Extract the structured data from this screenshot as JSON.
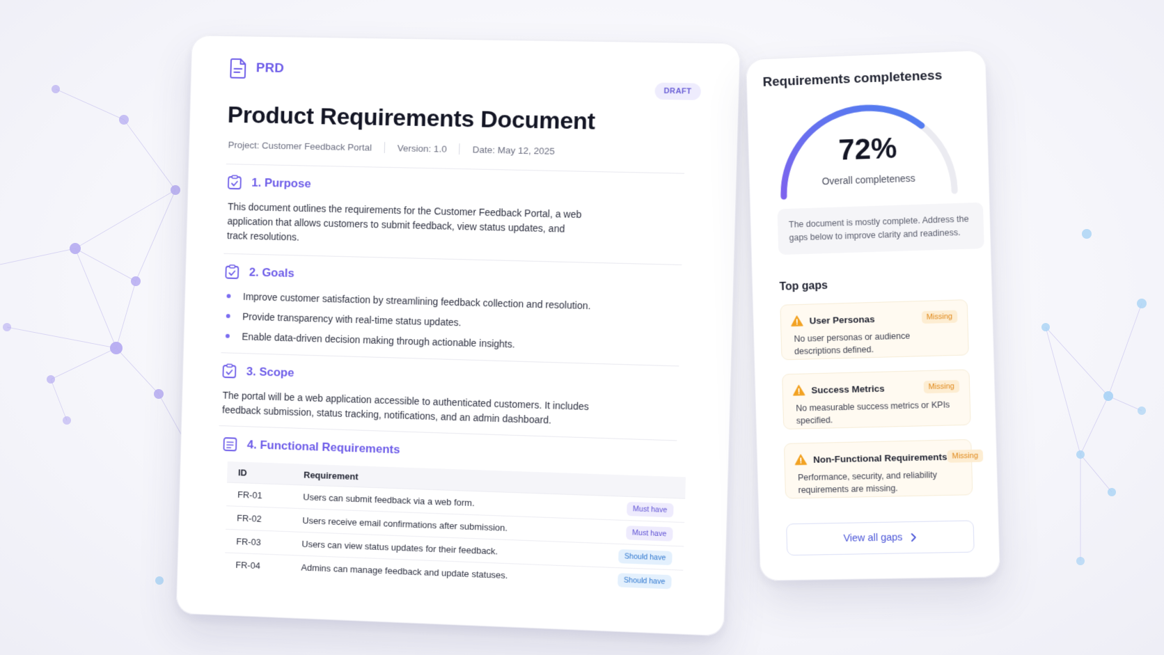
{
  "document": {
    "brand": "PRD",
    "status_badge": "DRAFT",
    "title": "Product Requirements Document",
    "meta": {
      "project": "Project: Customer Feedback Portal",
      "version": "Version: 1.0",
      "date": "Date: May 12, 2025"
    },
    "sections": {
      "purpose": {
        "title": "1. Purpose",
        "body": "This document outlines the requirements for the Customer Feedback Portal, a web application that allows customers to submit feedback, view status updates, and track resolutions."
      },
      "goals": {
        "title": "2. Goals",
        "items": [
          "Improve customer satisfaction by streamlining feedback collection and resolution.",
          "Provide transparency with real-time status updates.",
          "Enable data-driven decision making through actionable insights."
        ]
      },
      "scope": {
        "title": "3. Scope",
        "body": "The portal will be a web application accessible to authenticated customers. It includes feedback submission, status tracking, notifications, and an admin dashboard."
      },
      "functional": {
        "title": "4. Functional Requirements",
        "columns": [
          "ID",
          "Requirement"
        ],
        "rows": [
          {
            "id": "FR-01",
            "requirement": "Users can submit feedback via a web form.",
            "priority": "Must have"
          },
          {
            "id": "FR-02",
            "requirement": "Users receive email confirmations after submission.",
            "priority": "Must have"
          },
          {
            "id": "FR-03",
            "requirement": "Users can view status updates for their feedback.",
            "priority": "Should have"
          },
          {
            "id": "FR-04",
            "requirement": "Admins can manage feedback and update statuses.",
            "priority": "Should have"
          }
        ]
      }
    }
  },
  "completeness": {
    "title": "Requirements completeness",
    "value_label": "72%",
    "value": 0.72,
    "caption": "Overall completeness",
    "note": "The document is mostly complete. Address the gaps below to improve clarity and readiness.",
    "top_gaps_title": "Top gaps",
    "gaps": [
      {
        "name": "User Personas",
        "status": "Missing",
        "description": "No user personas or audience descriptions defined."
      },
      {
        "name": "Success Metrics",
        "status": "Missing",
        "description": "No measurable success metrics or KPIs specified."
      },
      {
        "name": "Non-Functional Requirements",
        "status": "Missing",
        "description": "Performance, security, and reliability requirements are missing."
      }
    ],
    "view_all_label": "View all gaps"
  },
  "colors": {
    "accent": "#6d5ce8",
    "warning": "#e59a25",
    "must_badge": "#eeebfd",
    "should_badge": "#e3f0fd"
  },
  "icons": [
    "document-icon",
    "checklist-icon",
    "list-icon",
    "warning-icon",
    "chevron-right-icon"
  ]
}
